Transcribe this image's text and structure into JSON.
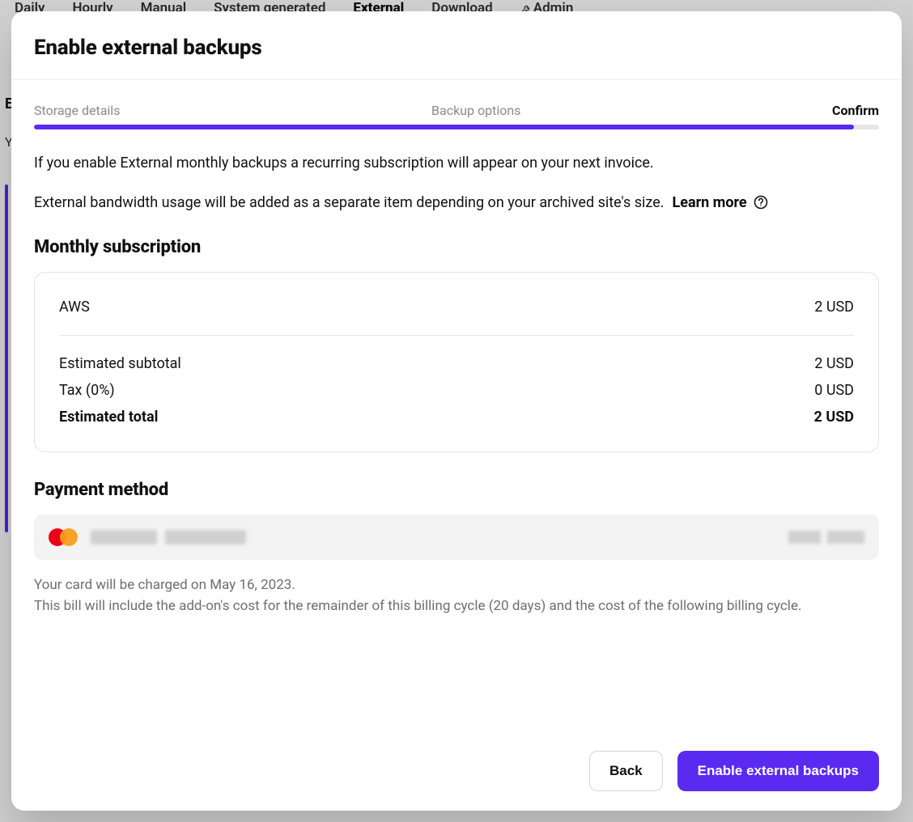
{
  "background": {
    "tabs": [
      "Daily",
      "Hourly",
      "Manual",
      "System generated",
      "External",
      "Download",
      "Admin"
    ],
    "activeTabIndex": 4,
    "cutoffLetterE": "E",
    "cutoffLetterY": "Y"
  },
  "modal": {
    "title": "Enable external backups",
    "steps": {
      "storage": "Storage details",
      "options": "Backup options",
      "confirm": "Confirm"
    },
    "progressPercent": 97,
    "description": "If you enable External monthly backups a recurring subscription will appear on your next invoice.",
    "bandwidthNote": "External bandwidth usage will be added as a separate item depending on your archived site's size.",
    "learnMore": "Learn more",
    "subscriptionHeading": "Monthly subscription",
    "pricing": {
      "provider": {
        "label": "AWS",
        "value": "2 USD"
      },
      "subtotal": {
        "label": "Estimated subtotal",
        "value": "2 USD"
      },
      "tax": {
        "label": "Tax (0%)",
        "value": "0 USD"
      },
      "total": {
        "label": "Estimated total",
        "value": "2 USD"
      }
    },
    "paymentHeading": "Payment method",
    "chargeNote1": "Your card will be charged on May 16, 2023.",
    "chargeNote2": "This bill will include the add-on's cost for the remainder of this billing cycle (20 days) and the cost of the following billing cycle.",
    "buttons": {
      "back": "Back",
      "confirm": "Enable external backups"
    }
  }
}
